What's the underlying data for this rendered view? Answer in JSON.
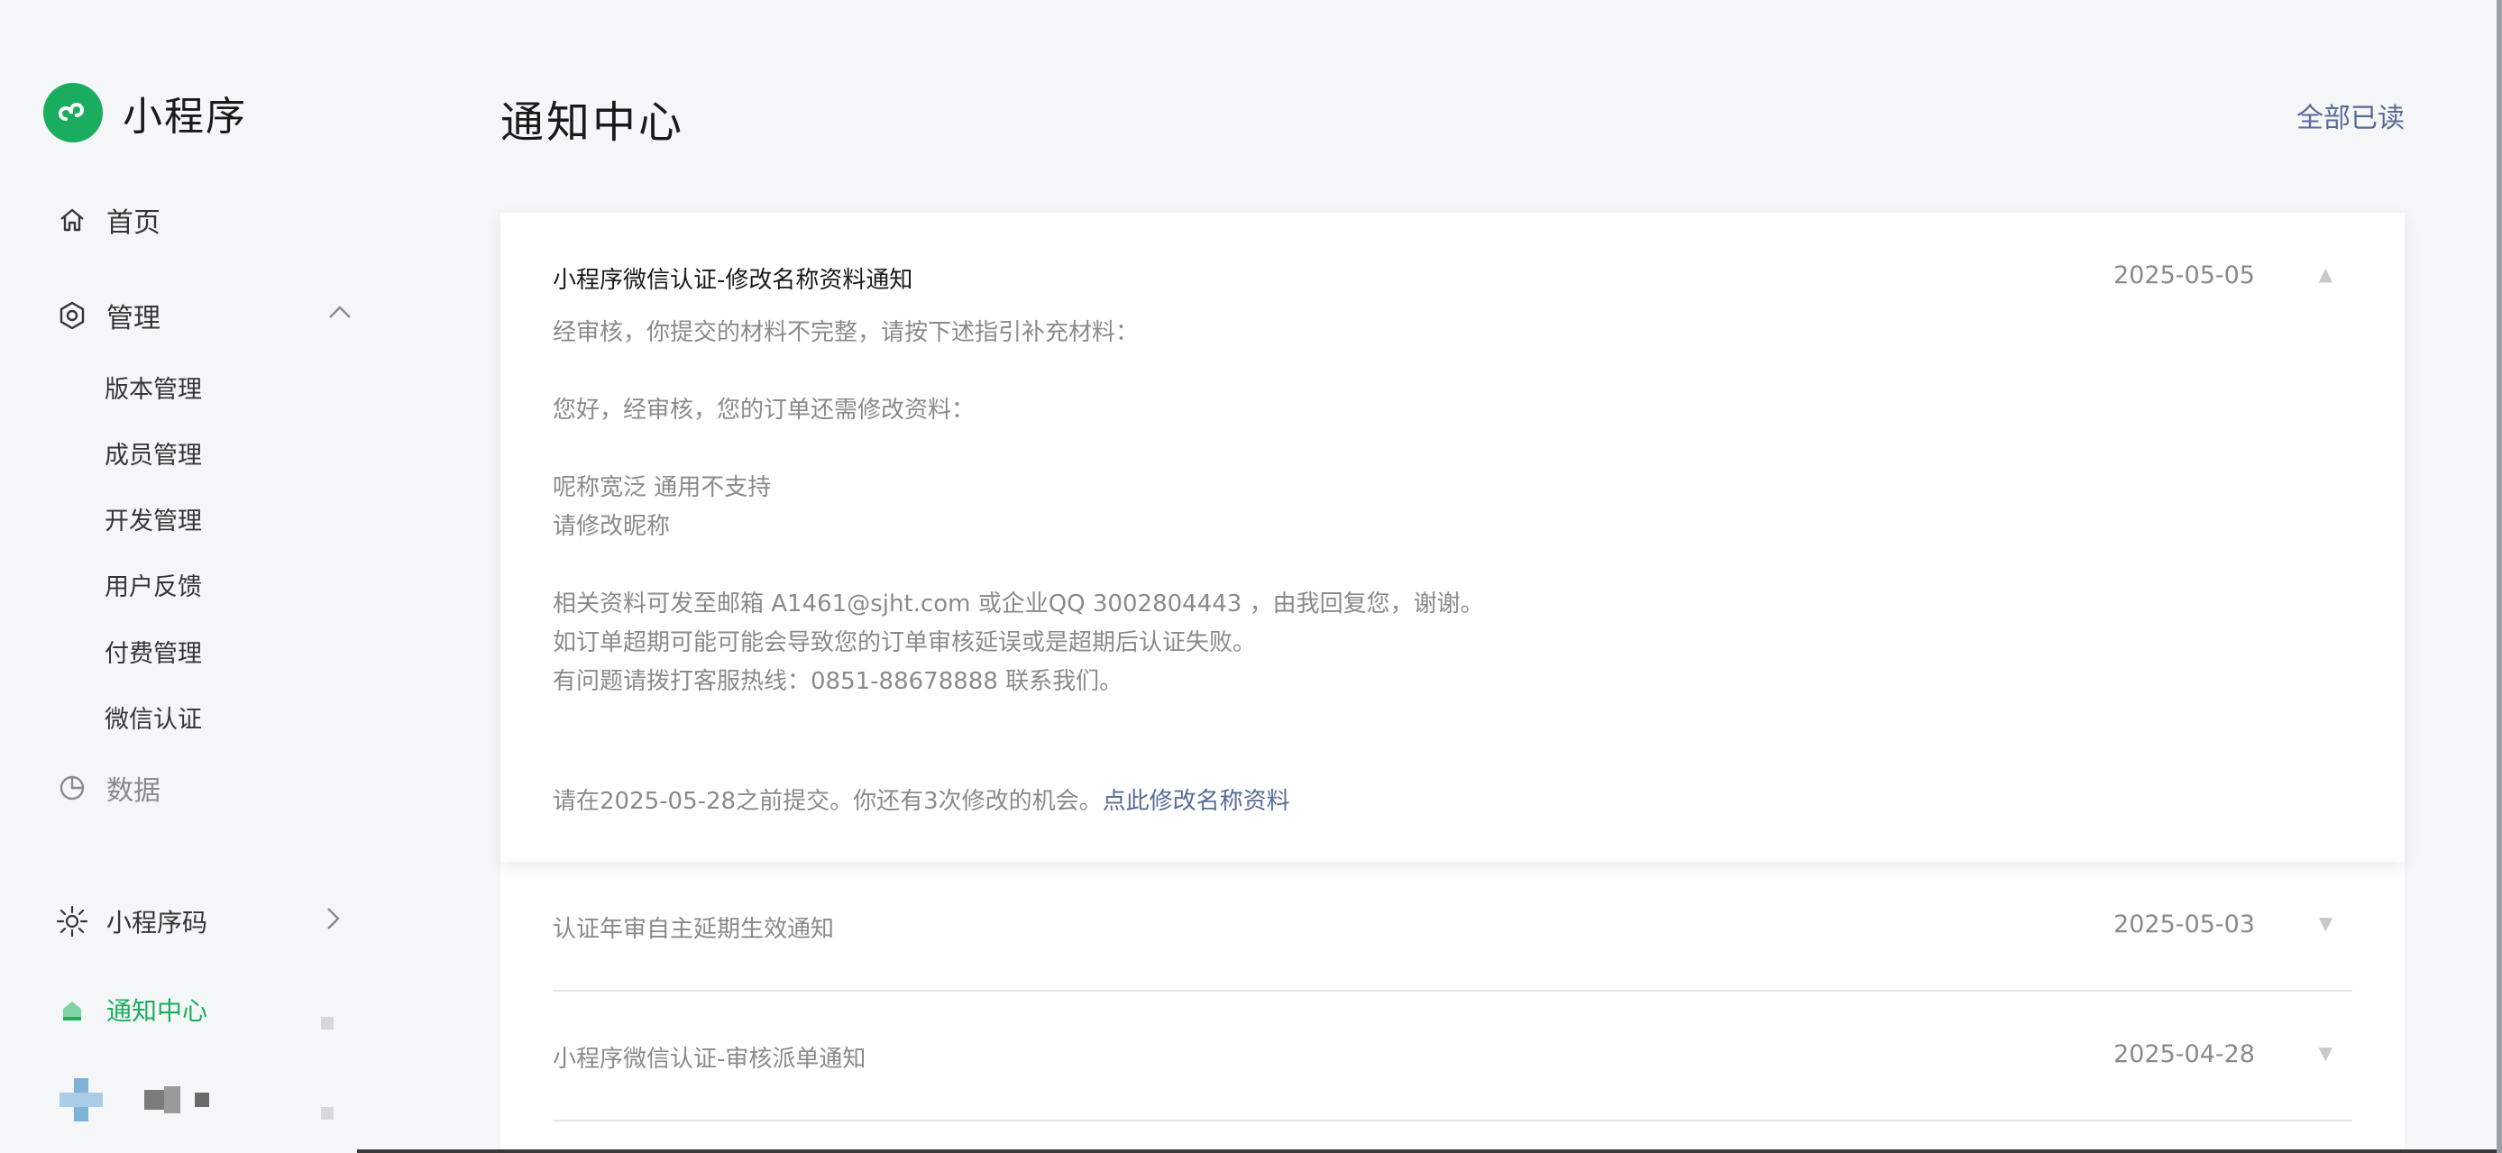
{
  "brand": {
    "title": "小程序",
    "logo_color": "#1aad5f",
    "logo_icon": "miniprogram-logo-icon"
  },
  "sidebar": {
    "home": {
      "label": "首页",
      "icon": "home-icon"
    },
    "manage": {
      "label": "管理",
      "icon": "manage-icon",
      "expanded": true,
      "items": [
        {
          "label": "版本管理"
        },
        {
          "label": "成员管理"
        },
        {
          "label": "开发管理"
        },
        {
          "label": "用户反馈"
        },
        {
          "label": "付费管理"
        },
        {
          "label": "微信认证"
        }
      ]
    },
    "data": {
      "label": "数据",
      "icon": "pie-chart-icon"
    },
    "code": {
      "label": "小程序码",
      "icon": "qrcode-sun-icon"
    },
    "notice": {
      "label": "通知中心",
      "icon": "bell-icon",
      "active_color": "#1aad5f"
    }
  },
  "header": {
    "title": "通知中心",
    "mark_all_read": "全部已读"
  },
  "notices": [
    {
      "title": "小程序微信认证-修改名称资料通知",
      "date": "2025-05-05",
      "expanded": true,
      "body": [
        "经审核，你提交的材料不完整，请按下述指引补充材料：",
        "",
        "您好，经审核，您的订单还需修改资料：",
        "",
        "呢称宽泛 通用不支持",
        "请修改昵称",
        "",
        "相关资料可发至邮箱 A1461@sjht.com 或企业QQ 3002804443 ，由我回复您，谢谢。",
        "如订单超期可能可能会导致您的订单审核延误或是超期后认证失败。",
        "有问题请拨打客服热线：0851-88678888 联系我们。"
      ],
      "footer_text": "请在2025-05-28之前提交。你还有3次修改的机会。",
      "footer_link": "点此修改名称资料"
    },
    {
      "title": "认证年审自主延期生效通知",
      "date": "2025-05-03",
      "expanded": false
    },
    {
      "title": "小程序微信认证-审核派单通知",
      "date": "2025-04-28",
      "expanded": false
    }
  ],
  "colors": {
    "accent": "#1aad5f",
    "link": "#576b95",
    "muted": "#8a8a8a"
  }
}
